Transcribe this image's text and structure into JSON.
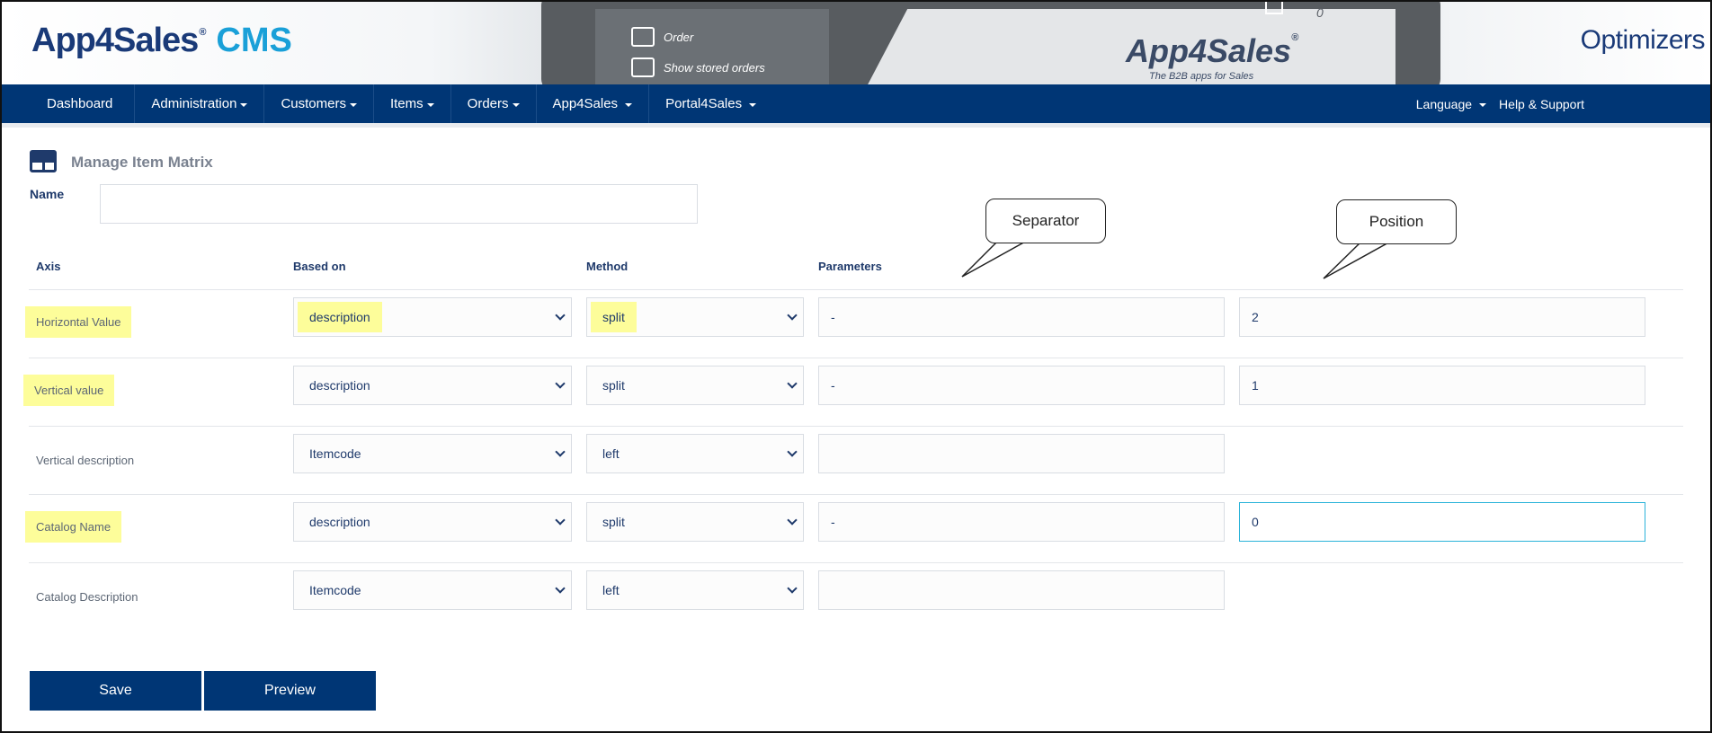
{
  "header": {
    "brand": "App4Sales",
    "brand_reg": "®",
    "brand_suffix": "CMS",
    "partner_logo": "Optimizers",
    "banner": {
      "menu_order": "Order",
      "menu_stored": "Show stored orders",
      "logo": "App4Sales",
      "logo_reg": "®",
      "tagline": "The B2B apps for Sales",
      "count": "0"
    }
  },
  "nav": {
    "items": [
      {
        "label": "Dashboard",
        "dropdown": false
      },
      {
        "label": "Administration",
        "dropdown": true
      },
      {
        "label": "Customers",
        "dropdown": true
      },
      {
        "label": "Items",
        "dropdown": true
      },
      {
        "label": "Orders",
        "dropdown": true
      },
      {
        "label": "App4Sales",
        "dropdown": true
      },
      {
        "label": "Portal4Sales",
        "dropdown": true
      }
    ],
    "language": "Language",
    "help": "Help & Support"
  },
  "page": {
    "title": "Manage Item Matrix",
    "name_label": "Name",
    "name_value": ""
  },
  "columns": {
    "axis": "Axis",
    "based_on": "Based on",
    "method": "Method",
    "parameters": "Parameters"
  },
  "rows": [
    {
      "axis": "Horizontal Value",
      "based_on": "description",
      "method": "split",
      "parameter": "-",
      "position": "2"
    },
    {
      "axis": "Vertical value",
      "based_on": "description",
      "method": "split",
      "parameter": "-",
      "position": "1"
    },
    {
      "axis": "Vertical description",
      "based_on": "Itemcode",
      "method": "left",
      "parameter": ""
    },
    {
      "axis": "Catalog Name",
      "based_on": "description",
      "method": "split",
      "parameter": "-",
      "position": "0"
    },
    {
      "axis": "Catalog Description",
      "based_on": "Itemcode",
      "method": "left",
      "parameter": ""
    }
  ],
  "callouts": {
    "separator": "Separator",
    "position": "Position"
  },
  "actions": {
    "save": "Save",
    "preview": "Preview"
  },
  "colors": {
    "nav_bg": "#003675",
    "highlight": "#fdfd9a",
    "focus_border": "#2bb3d9"
  }
}
